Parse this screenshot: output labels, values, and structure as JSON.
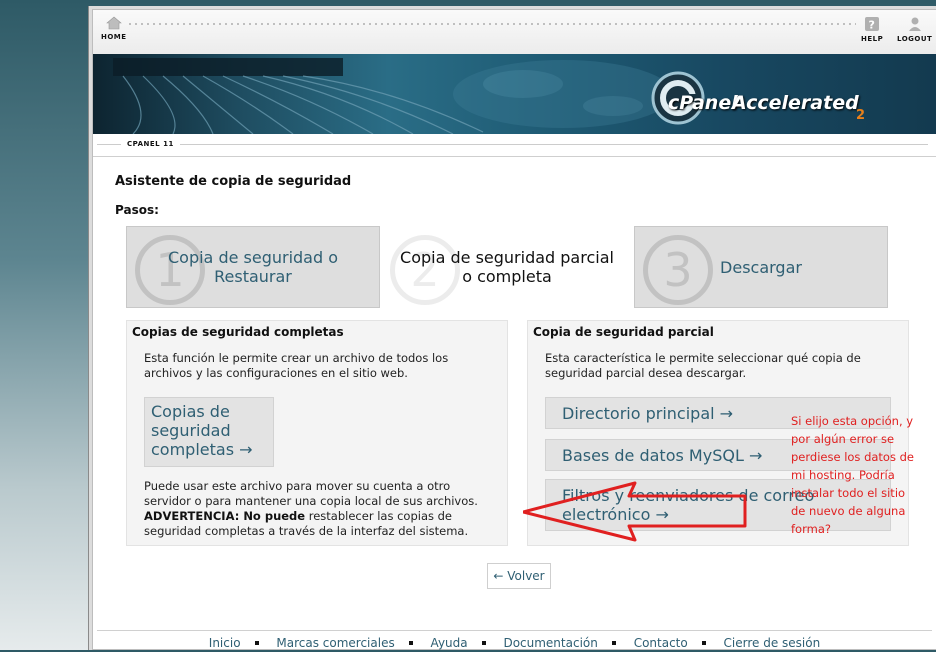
{
  "nav": {
    "home_label": "HOME",
    "help_label": "HELP",
    "logout_label": "LOGOUT"
  },
  "banner": {
    "brand_cpanel": "cPanel",
    "brand_accelerated": "Accelerated",
    "brand_version": "2"
  },
  "breadcrumb": "CPANEL 11",
  "page_title": "Asistente de copia de seguridad",
  "steps_label": "Pasos:",
  "steps": [
    {
      "number": "1",
      "label": "Copia de seguridad o Restaurar"
    },
    {
      "number": "2",
      "label": "Copia de seguridad parcial o completa"
    },
    {
      "number": "3",
      "label": "Descargar"
    }
  ],
  "full_backup": {
    "heading": "Copias de seguridad completas",
    "description": "Esta función le permite crear un archivo de todos los archivos y las configuraciones en el sitio web.",
    "button_label": "Copias de seguridad completas →",
    "note": "Puede usar este archivo para mover su cuenta a otro servidor o para mantener una copia local de sus archivos.",
    "warning_prefix": "ADVERTENCIA",
    "warning_bold": "No puede",
    "warning_rest": "restablecer las copias de seguridad completas a través de la interfaz del sistema."
  },
  "partial_backup": {
    "heading": "Copia de seguridad parcial",
    "description": "Esta característica le permite seleccionar qué copia de seguridad parcial desea descargar.",
    "options": [
      "Directorio principal →",
      "Bases de datos MySQL →",
      "Filtros y reenviadores de correo electrónico →"
    ]
  },
  "back_button": "← Volver",
  "footer_links": [
    "Inicio",
    "Marcas comerciales",
    "Ayuda",
    "Documentación",
    "Contacto",
    "Cierre de sesión"
  ],
  "annotation": "Si elijo esta opción, y por algún error se perdiese los datos de mi hosting. Podría instalar todo el sitio de nuevo de alguna forma?",
  "colors": {
    "link": "#2f5f73",
    "annotation": "#e02020",
    "step_inactive": "#dedede",
    "panel": "#f4f4f4"
  }
}
